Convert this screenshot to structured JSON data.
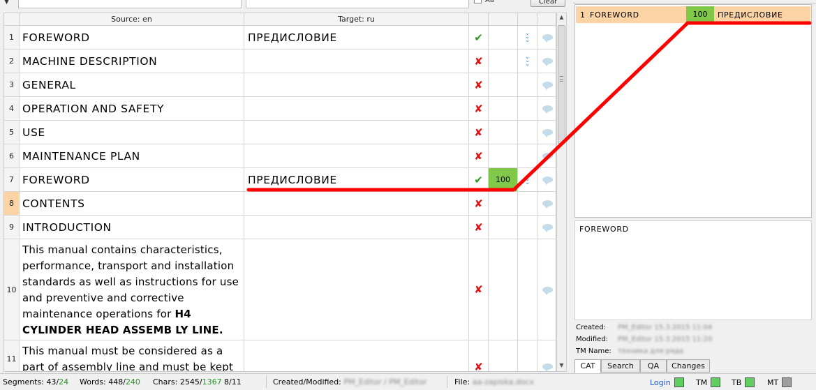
{
  "filter_bar": {
    "case_label": "Aa",
    "clear_label": "Clear"
  },
  "grid": {
    "headers": {
      "source": "Source: en",
      "target": "Target: ru"
    },
    "rows": [
      {
        "num": "1",
        "source": "FOREWORD",
        "target": "ПРЕДИСЛОВИЕ",
        "status": "✔",
        "match": "",
        "dbl": true
      },
      {
        "num": "2",
        "source": "MACHINE DESCRIPTION",
        "target": "",
        "status": "✘",
        "match": "",
        "dbl": true
      },
      {
        "num": "3",
        "source": "GENERAL",
        "target": "",
        "status": "✘",
        "match": "",
        "dbl": false
      },
      {
        "num": "4",
        "source": "OPERATION AND SAFETY",
        "target": "",
        "status": "✘",
        "match": "",
        "dbl": false
      },
      {
        "num": "5",
        "source": "USE",
        "target": "",
        "status": "✘",
        "match": "",
        "dbl": false
      },
      {
        "num": "6",
        "source": "MAINTENANCE PLAN",
        "target": "",
        "status": "✘",
        "match": "",
        "dbl": false
      },
      {
        "num": "7",
        "source": "FOREWORD",
        "target": "ПРЕДИСЛОВИЕ",
        "status": "✔",
        "match": "100",
        "dbl": true
      },
      {
        "num": "8",
        "source": "CONTENTS",
        "target": "",
        "status": "✘",
        "match": "",
        "dbl": false
      },
      {
        "num": "9",
        "source": "INTRODUCTION",
        "target": "",
        "status": "✘",
        "match": "",
        "dbl": false
      },
      {
        "num": "10",
        "source_pre": "This manual contains characteristics, performance, transport and installation standards as well as instructions for use and preventive and corrective maintenance operations for ",
        "source_bold1": "H4 CYLINDER HEAD ASSEMB",
        "source_mid": " ",
        "source_bold2": "LY LINE.",
        "target": "",
        "status": "✘",
        "match": "",
        "dbl": false
      },
      {
        "num": "11",
        "source": "This manual must be considered as a part of assembly line and must be kept",
        "target": "",
        "status": "✘",
        "match": "",
        "dbl": false
      }
    ]
  },
  "tm_panel": {
    "match": {
      "num": "1",
      "source": "FOREWORD",
      "score": "100",
      "target": "ПРЕДИСЛОВИЕ"
    },
    "preview": "FOREWORD",
    "meta": {
      "created_label": "Created:",
      "created_value": "PM_Editor 15.3.2015 11:04",
      "modified_label": "Modified:",
      "modified_value": "PM_Editor 15.3.2015 11:20",
      "tmname_label": "TM Name:",
      "tmname_value": "техника для ряда"
    },
    "tabs": [
      "CAT",
      "Search",
      "QA",
      "Changes"
    ]
  },
  "status_bar": {
    "segments_label": "Segments:",
    "segments_total": "43",
    "segments_slash": "/",
    "segments_done": "24",
    "words_label": "Words:",
    "words_total": "448",
    "words_slash": "/",
    "words_done": "240",
    "chars_label": "Chars:",
    "chars_total": "2545",
    "chars_slash": "/",
    "chars_done": "1367",
    "position": "8/11",
    "created_label": "Created/Modified:",
    "created_value": "PM_Editor / PM_Editor",
    "file_label": "File:",
    "file_value": "aa-zapiska.docx",
    "login_label": "Login",
    "tm_label": "TM",
    "tb_label": "TB",
    "mt_label": "MT"
  },
  "colors": {
    "active_row": "#fbd3a4",
    "match_green": "#7fc84a",
    "ok_green": "#2a9a1e",
    "error_red": "#e01010",
    "annotation_red": "#ff0000",
    "indicator_on": "#5fd05f",
    "indicator_off": "#9e9e9e"
  },
  "icons": {
    "status_ok": "check-icon",
    "status_error": "cross-icon",
    "double_chevron": "double-chevron-down-icon",
    "comment": "comment-bubble-icon"
  }
}
